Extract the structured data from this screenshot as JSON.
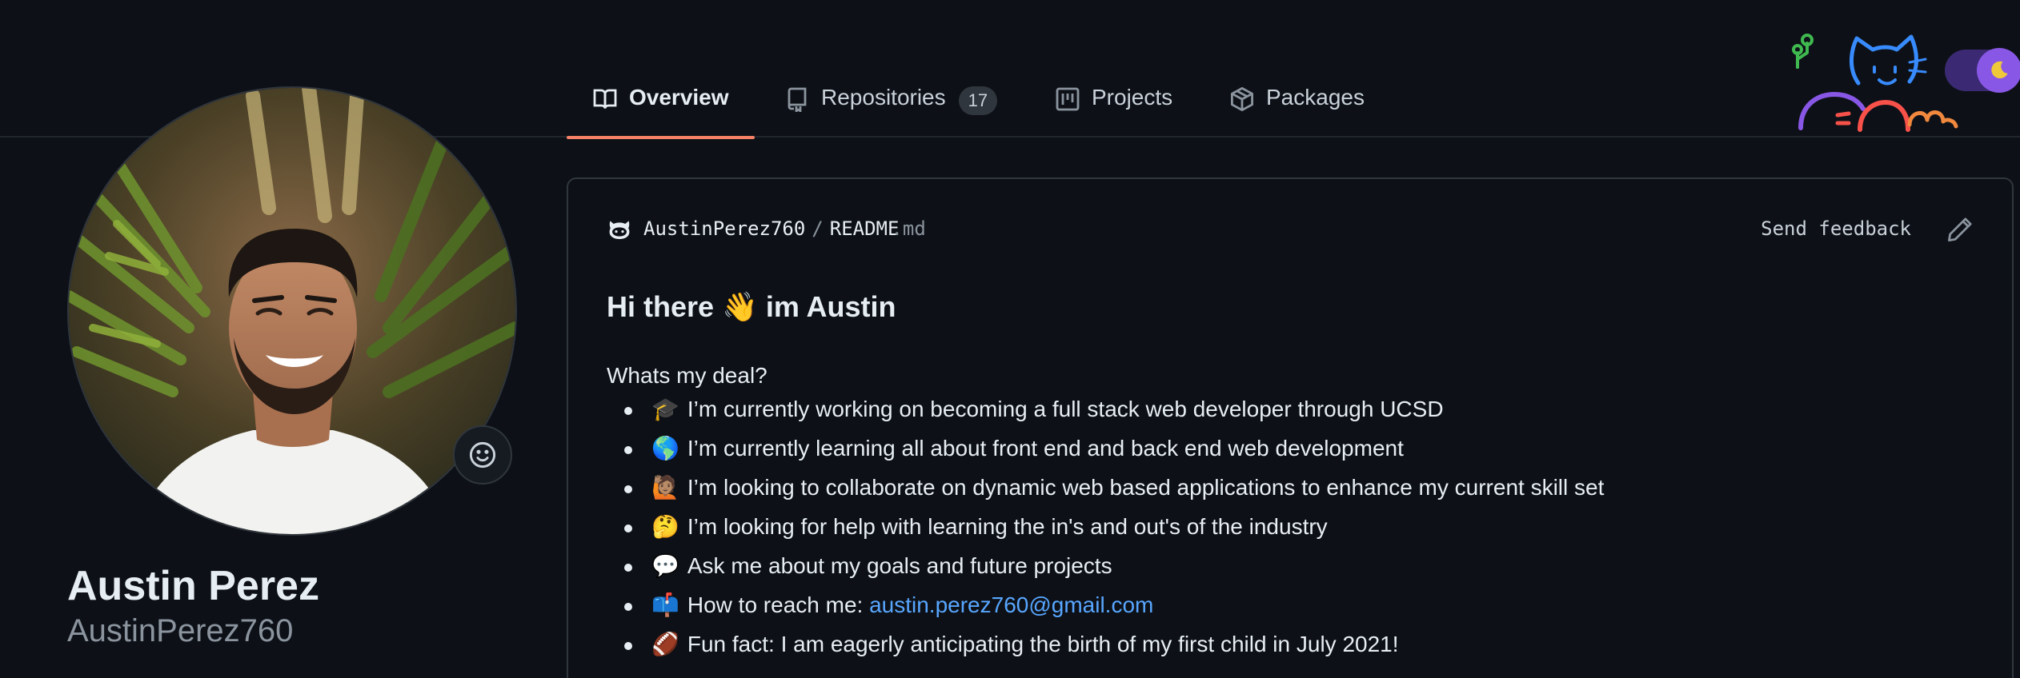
{
  "tabs": [
    {
      "label": "Overview",
      "icon": "book-icon",
      "active": true
    },
    {
      "label": "Repositories",
      "icon": "repo-icon",
      "count": "17"
    },
    {
      "label": "Projects",
      "icon": "project-icon"
    },
    {
      "label": "Packages",
      "icon": "package-icon"
    }
  ],
  "profile": {
    "full_name": "Austin Perez",
    "username": "AustinPerez760",
    "avatar": "profile-photo",
    "status_icon": "smiley-icon"
  },
  "readme": {
    "owner": "AustinPerez760",
    "separator": "/",
    "file_name": "README",
    "file_ext": ".md",
    "send_feedback": "Send feedback",
    "title": "Hi there 👋 im Austin",
    "intro": "Whats my deal?",
    "bullets": [
      {
        "emoji": "🎓",
        "text": "I’m currently working on becoming a full stack web developer through UCSD"
      },
      {
        "emoji": "🌎",
        "text": "I’m currently learning all about front end and back end web development"
      },
      {
        "emoji": "🙋🏽",
        "text": "I’m looking to collaborate on dynamic web based applications to enhance my current skill set"
      },
      {
        "emoji": "🤔",
        "text": "I’m looking for help with learning the in's and out's of the industry"
      },
      {
        "emoji": "💬",
        "text": "Ask me about my goals and future projects"
      },
      {
        "emoji": "📫",
        "text": "How to reach me: ",
        "link": "austin.perez760@gmail.com"
      },
      {
        "emoji": "🏈",
        "text": "Fun fact: I am eagerly anticipating the birth of my first child in July 2021!"
      }
    ]
  },
  "colors": {
    "background": "#0d1117",
    "accent_underline": "#f78166",
    "link": "#58a6ff",
    "toggle": "#8957e5"
  }
}
